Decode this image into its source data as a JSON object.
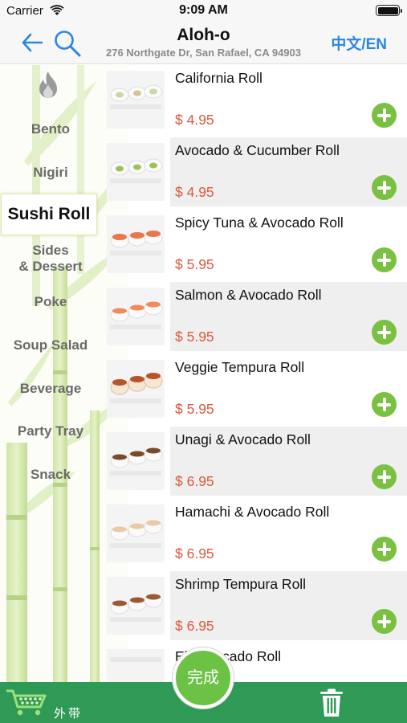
{
  "status_bar": {
    "carrier": "Carrier",
    "time": "9:09 AM",
    "icons": [
      "wifi-icon",
      "battery-icon"
    ]
  },
  "nav": {
    "title": "Aloh-o",
    "subtitle": "276 Northgate Dr, San Rafael, CA 94903",
    "language_toggle": "中文/EN",
    "icons": [
      "back-arrow-icon",
      "search-icon"
    ]
  },
  "categories": [
    {
      "label": "",
      "icon": "fire-icon"
    },
    {
      "label": "Bento"
    },
    {
      "label": "Nigiri"
    },
    {
      "label": "Sushi Roll",
      "active": true
    },
    {
      "label": "Sides\n& Dessert"
    },
    {
      "label": "Poke"
    },
    {
      "label": "Soup Salad"
    },
    {
      "label": "Beverage"
    },
    {
      "label": "Party Tray"
    },
    {
      "label": "Snack"
    }
  ],
  "items": [
    {
      "name": "California Roll",
      "price": "$ 4.95"
    },
    {
      "name": "Avocado & Cucumber Roll",
      "price": "$ 4.95"
    },
    {
      "name": "Spicy Tuna & Avocado Roll",
      "price": "$ 5.95"
    },
    {
      "name": "Salmon & Avocado Roll",
      "price": "$ 5.95"
    },
    {
      "name": "Veggie Tempura Roll",
      "price": "$ 5.95"
    },
    {
      "name": "Unagi & Avocado Roll",
      "price": "$ 6.95"
    },
    {
      "name": "Hamachi & Avocado Roll",
      "price": "$ 6.95"
    },
    {
      "name": "Shrimp Tempura Roll",
      "price": "$ 6.95"
    },
    {
      "name": "Ebi Avocado Roll",
      "price": ""
    }
  ],
  "bottom_bar": {
    "cart_label": "外带",
    "done_label": "完成",
    "icons": [
      "cart-icon",
      "trash-icon"
    ]
  },
  "colors": {
    "accent_blue": "#2a86e6",
    "price_red": "#e0573a",
    "add_green": "#7ac142",
    "bar_green": "#2e9a55"
  }
}
